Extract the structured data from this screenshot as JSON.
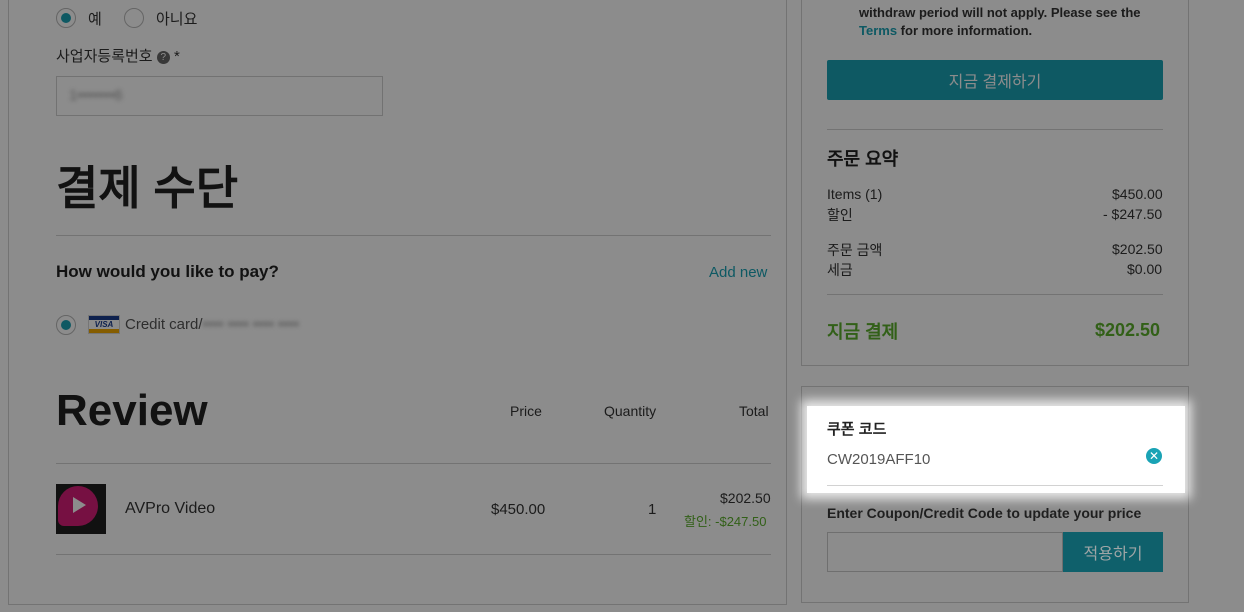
{
  "company": {
    "radio_yes": "예",
    "radio_no": "아니요",
    "reg_label": "사업자등록번호",
    "required_mark": "*",
    "reg_value_masked": "1•••••••6"
  },
  "payment": {
    "heading": "결제 수단",
    "question": "How would you like to pay?",
    "add_new": "Add new",
    "card_brand": "VISA",
    "card_label": "Credit card/",
    "card_number_masked": "•••• •••• •••• ••••"
  },
  "review": {
    "heading": "Review",
    "col_price": "Price",
    "col_quantity": "Quantity",
    "col_total": "Total",
    "item": {
      "name": "AVPro Video",
      "price": "$450.00",
      "quantity": "1",
      "total": "$202.50",
      "discount": "할인: -$247.50"
    }
  },
  "notice": {
    "line1": "withdraw period will not apply. Please see the",
    "terms_link": "Terms",
    "line2_rest": " for more information."
  },
  "summary": {
    "pay_now_button": "지금 결제하기",
    "title": "주문 요약",
    "items_label": "Items (1)",
    "items_value": "$450.00",
    "discount_label": "할인",
    "discount_value": "- $247.50",
    "order_amount_label": "주문 금액",
    "order_amount_value": "$202.50",
    "tax_label": "세금",
    "tax_value": "$0.00",
    "total_label": "지금 결제",
    "total_value": "$202.50"
  },
  "coupon": {
    "title": "쿠폰 코드",
    "applied_code": "CW2019AFF10",
    "enter_label": "Enter Coupon/Credit Code to update your price",
    "input_placeholder": "",
    "apply_button": "적용하기"
  },
  "colors": {
    "accent": "#1aa3b5",
    "discount_green": "#5cb02c"
  }
}
